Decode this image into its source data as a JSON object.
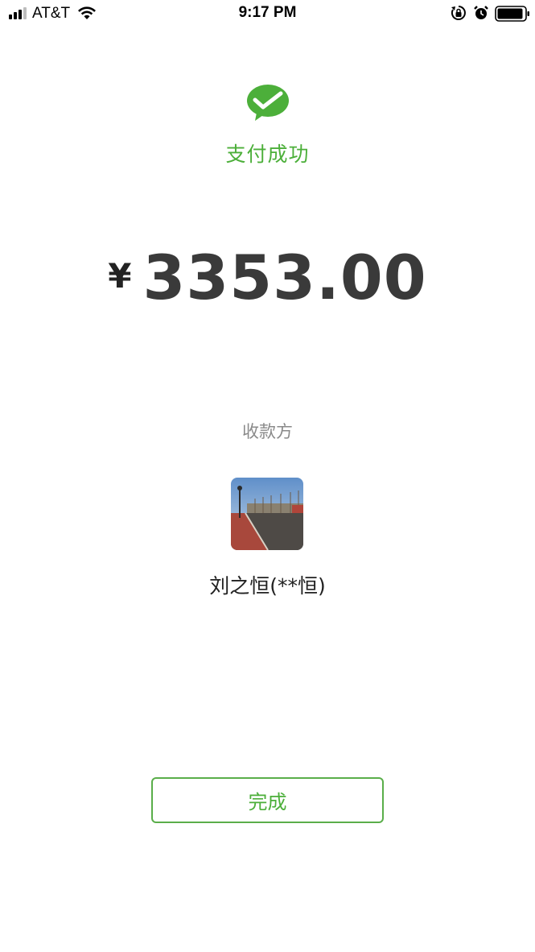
{
  "status_bar": {
    "carrier": "AT&T",
    "time": "9:17 PM",
    "icons": [
      "signal-icon",
      "wifi-icon",
      "rotation-lock-icon",
      "alarm-icon",
      "battery-icon"
    ]
  },
  "payment": {
    "status_text": "支付成功",
    "currency_symbol": "¥",
    "amount": "3353.00"
  },
  "payee": {
    "label": "收款方",
    "name": "刘之恒(**恒)",
    "avatar_icon": "avatar-photo"
  },
  "actions": {
    "done_label": "完成"
  },
  "colors": {
    "accent_green": "#4caf3a",
    "text_dark": "#333333",
    "text_muted": "#8a8a8a"
  }
}
